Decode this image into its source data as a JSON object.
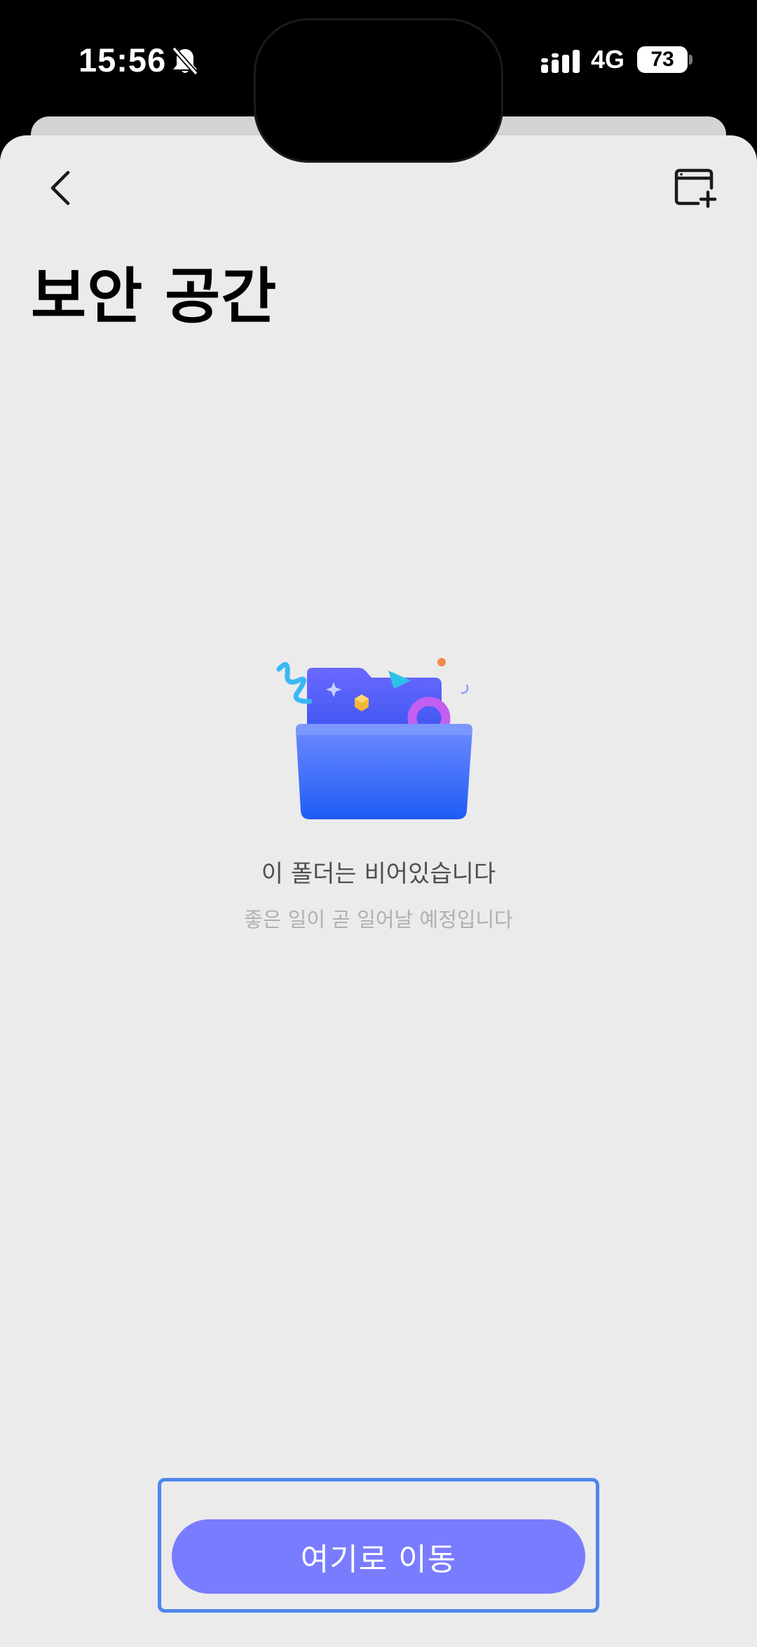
{
  "status_bar": {
    "time": "15:56",
    "network": "4G",
    "battery": "73",
    "icons": [
      "bell-slash-icon",
      "signal-icon",
      "battery-icon"
    ]
  },
  "nav": {
    "back_icon": "chevron-left-icon",
    "action_icon": "new-window-icon"
  },
  "page": {
    "title": "보안 공간"
  },
  "empty_state": {
    "illustration": "folder-illustration",
    "title": "이 폴더는 비어있습니다",
    "subtitle": "좋은 일이 곧 일어날 예정입니다"
  },
  "footer": {
    "button_label": "여기로 이동"
  },
  "colors": {
    "background": "#ebebeb",
    "button": "#7a7cff",
    "focus_outline": "#4f86ec",
    "folder": "#3c6cff"
  }
}
